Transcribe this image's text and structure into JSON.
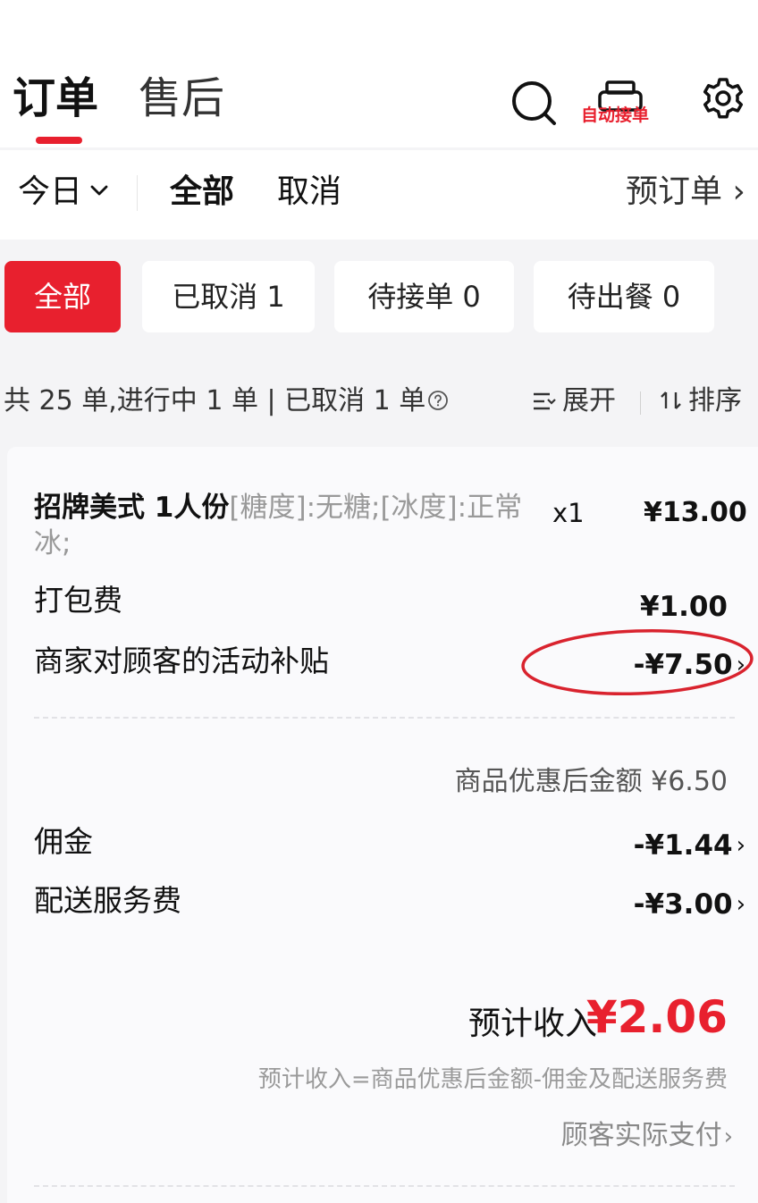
{
  "header": {
    "tabs": [
      {
        "label": "订单",
        "active": true
      },
      {
        "label": "售后",
        "active": false
      }
    ],
    "auto_accept_label": "自动接单",
    "icons": [
      "search-icon",
      "printer-icon",
      "gear-icon"
    ]
  },
  "filter_bar": {
    "date_label": "今日",
    "all_label": "全部",
    "cancel_label": "取消",
    "preorder_label": "预订单",
    "preorder_chevron": "›"
  },
  "status_chips": [
    {
      "label": "全部",
      "active": true
    },
    {
      "label": "已取消 1",
      "active": false
    },
    {
      "label": "待接单 0",
      "active": false
    },
    {
      "label": "待出餐 0",
      "active": false
    }
  ],
  "summary": {
    "text": "共 25 单,进行中 1 单 | 已取消 1 单",
    "expand_label": "展开",
    "sort_label": "排序"
  },
  "order": {
    "item_name": "招牌美式 1人份",
    "item_spec": "[糖度]:无糖;[冰度]:正常冰;",
    "item_qty": "x1",
    "item_price": "¥13.00",
    "packing_fee_label": "打包费",
    "packing_fee_value": "¥1.00",
    "subsidy_label": "商家对顾客的活动补贴",
    "subsidy_value": "-¥7.50",
    "discounted_total": "商品优惠后金额 ¥6.50",
    "commission_label": "佣金",
    "commission_value": "-¥1.44",
    "delivery_fee_label": "配送服务费",
    "delivery_fee_value": "-¥3.00",
    "income_label": "预计收入",
    "income_value": "¥2.06",
    "income_formula": "预计收入=商品优惠后金额-佣金及配送服务费",
    "actual_pay_label": "顾客实际支付",
    "chevron": "›"
  },
  "colors": {
    "accent": "#e8202e",
    "page_bg": "#f4f4f6",
    "card_bg": "#fafafc"
  }
}
